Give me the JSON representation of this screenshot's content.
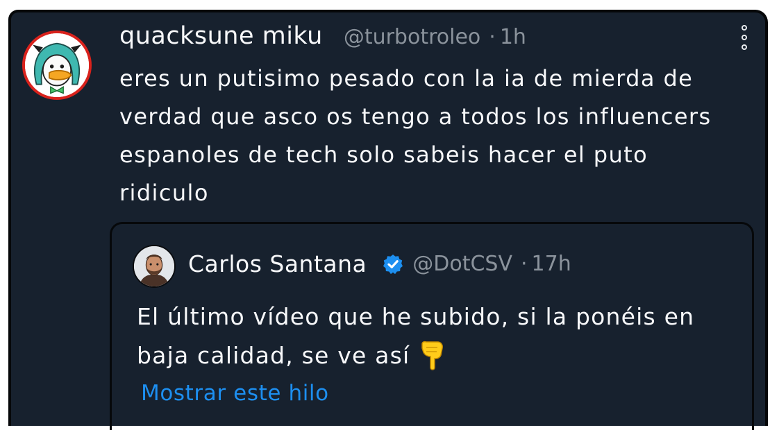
{
  "tweet": {
    "author_name": "quacksune miku",
    "handle": "@turbotroleo",
    "separator": "·",
    "time": "1h",
    "text": "eres un putisimo pesado con la ia de mierda de verdad que asco os tengo a todos los influencers espanoles de tech solo sabeis hacer el puto ridiculo",
    "avatar_icon": "duck-miku-avatar",
    "menu_icon": "more-options-vertical-dots-icon"
  },
  "quoted_tweet": {
    "author_name": "Carlos Santana",
    "verified": true,
    "verified_icon": "verified-badge-icon",
    "handle": "@DotCSV",
    "separator": "·",
    "time": "17h",
    "text": "El último vídeo que he subido, si la ponéis en baja calidad, se ve así",
    "emoji_icon": "pointing-down-hand-icon",
    "show_thread_label": "Mostrar este hilo"
  },
  "colors": {
    "background": "#17212e",
    "text": "#f7f8fa",
    "muted": "#8b939c",
    "link": "#1d8ff0",
    "verified": "#1d8ff0",
    "avatar_ring": "#d9221c"
  }
}
